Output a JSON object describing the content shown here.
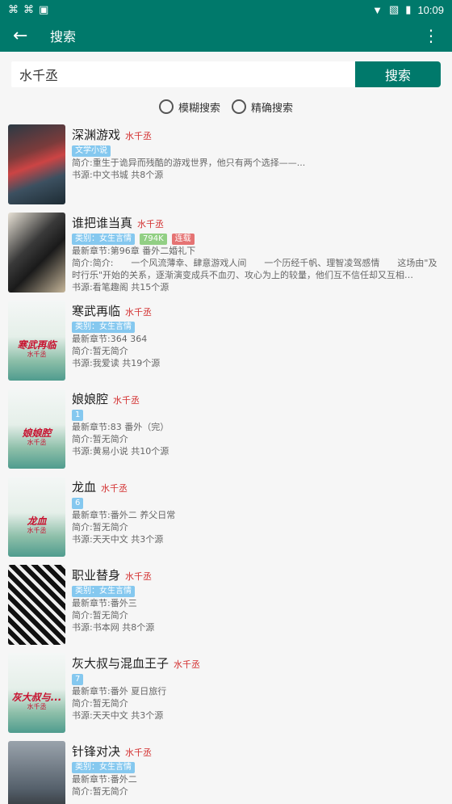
{
  "status": {
    "time": "10:09",
    "battery": "battery-icon"
  },
  "appbar": {
    "title": "搜索"
  },
  "search": {
    "value": "水千丞",
    "button": "搜索"
  },
  "modes": {
    "fuzzy": "模糊搜索",
    "exact": "精确搜索"
  },
  "books": [
    {
      "name": "深渊游戏",
      "author": "水千丞",
      "tags": [
        "文学小说"
      ],
      "tag_colors": [
        "blue"
      ],
      "latest": "",
      "intro": "简介:重生于诡异而残酷的游戏世界，他只有两个选择——...",
      "source": "书源:中文书城 共8个源",
      "cover": "dark",
      "cover_title": "",
      "cover_author": ""
    },
    {
      "name": "谁把谁当真",
      "author": "水千丞",
      "tags": [
        "类别：女生言情",
        "794K",
        "连载"
      ],
      "tag_colors": [
        "blue",
        "green",
        "red"
      ],
      "latest": "最新章节:第96章 番外二婚礼下",
      "intro": "简介:简介:　　一个风流薄幸、肆意游戏人间　　一个历经千帆、理智凌驾感情　　这场由\"及时行乐\"开始的关系，逐渐演变成兵不血刃、攻心为上的较量，他们互不信任却又互相…",
      "source": "书源:看笔趣阁 共15个源",
      "cover": "photo",
      "cover_title": "",
      "cover_author": ""
    },
    {
      "name": "寒武再临",
      "author": "水千丞",
      "tags": [
        "类别：女生言情"
      ],
      "tag_colors": [
        "blue"
      ],
      "latest": "最新章节:364 364",
      "intro": "简介:暂无简介",
      "source": "书源:我爱读 共19个源",
      "cover": "default",
      "cover_title": "寒武再临",
      "cover_author": "水千丞"
    },
    {
      "name": "娘娘腔",
      "author": "水千丞",
      "tags": [
        "1"
      ],
      "tag_colors": [
        "blue"
      ],
      "latest": "最新章节:83 番外（完）",
      "intro": "简介:暂无简介",
      "source": "书源:黄易小说 共10个源",
      "cover": "default",
      "cover_title": "娘娘腔",
      "cover_author": "水千丞"
    },
    {
      "name": "龙血",
      "author": "水千丞",
      "tags": [
        "6"
      ],
      "tag_colors": [
        "blue"
      ],
      "latest": "最新章节:番外二 养父日常",
      "intro": "简介:暂无简介",
      "source": "书源:天天中文 共3个源",
      "cover": "default",
      "cover_title": "龙血",
      "cover_author": "水千丞"
    },
    {
      "name": "职业替身",
      "author": "水千丞",
      "tags": [
        "类别：女生言情"
      ],
      "tag_colors": [
        "blue"
      ],
      "latest": "最新章节:番外三",
      "intro": "简介:暂无简介",
      "source": "书源:书本网 共8个源",
      "cover": "bw",
      "cover_title": "",
      "cover_author": ""
    },
    {
      "name": "灰大叔与混血王子",
      "author": "水千丞",
      "tags": [
        "7"
      ],
      "tag_colors": [
        "blue"
      ],
      "latest": "最新章节:番外 夏日旅行",
      "intro": "简介:暂无简介",
      "source": "书源:天天中文 共3个源",
      "cover": "default",
      "cover_title": "灰大叔与...",
      "cover_author": "水千丞"
    },
    {
      "name": "针锋对决",
      "author": "水千丞",
      "tags": [
        "类别：女生言情"
      ],
      "tag_colors": [
        "blue"
      ],
      "latest": "最新章节:番外二",
      "intro": "简介:暂无简介",
      "source": "",
      "cover": "night",
      "cover_title": "",
      "cover_author": ""
    }
  ]
}
